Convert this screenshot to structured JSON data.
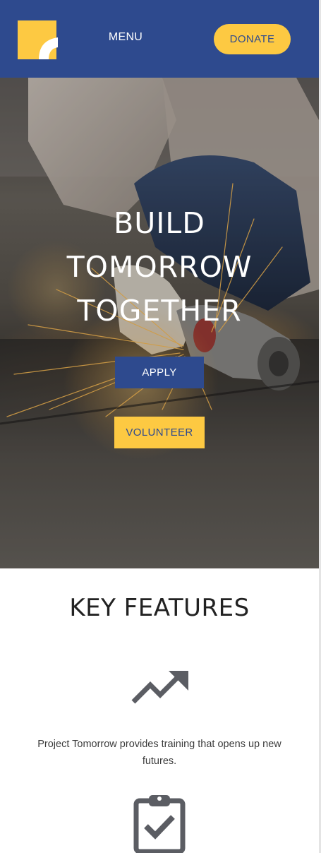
{
  "header": {
    "logo_icon": "brand-logo-icon",
    "menu_label": "MENU",
    "donate_label": "DONATE"
  },
  "hero": {
    "title_lines": [
      "BUILD",
      "TOMORROW",
      "TOGETHER"
    ],
    "apply_label": "APPLY",
    "volunteer_label": "VOLUNTEER"
  },
  "features": {
    "title": "KEY FEATURES",
    "items": [
      {
        "icon": "trending-up-icon",
        "text": "Project Tomorrow provides training that opens up new futures."
      },
      {
        "icon": "clipboard-check-icon",
        "text": ""
      }
    ]
  },
  "colors": {
    "brand_blue": "#2e4a8e",
    "brand_yellow": "#fdc942",
    "icon_gray": "#5b5d63",
    "text_dark": "#222222"
  }
}
